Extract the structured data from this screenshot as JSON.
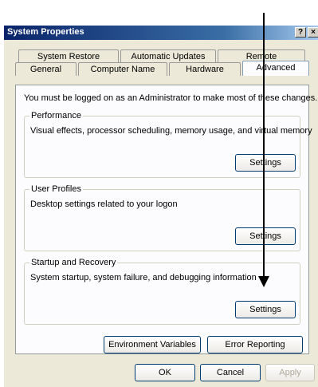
{
  "window": {
    "title": "System Properties",
    "help_label": "?",
    "close_label": "×"
  },
  "tabs": {
    "row1": [
      "System Restore",
      "Automatic Updates",
      "Remote"
    ],
    "row2": [
      "General",
      "Computer Name",
      "Hardware",
      "Advanced"
    ],
    "active": "Advanced"
  },
  "advanced": {
    "intro": "You must be logged on as an Administrator to make most of these changes.",
    "performance": {
      "title": "Performance",
      "description": "Visual effects, processor scheduling, memory usage, and virtual memory",
      "settings_label": "Settings"
    },
    "user_profiles": {
      "title": "User Profiles",
      "description": "Desktop settings related to your logon",
      "settings_label": "Settings"
    },
    "startup_recovery": {
      "title": "Startup and Recovery",
      "description": "System startup, system failure, and debugging information",
      "settings_label": "Settings"
    },
    "environment_variables_label": "Environment Variables",
    "error_reporting_label": "Error Reporting"
  },
  "footer": {
    "ok_label": "OK",
    "cancel_label": "Cancel",
    "apply_label": "Apply"
  },
  "colors": {
    "titlebar_start": "#0a246a",
    "dialog_bg": "#ece9d8",
    "panel_bg": "#fcfcfe"
  }
}
